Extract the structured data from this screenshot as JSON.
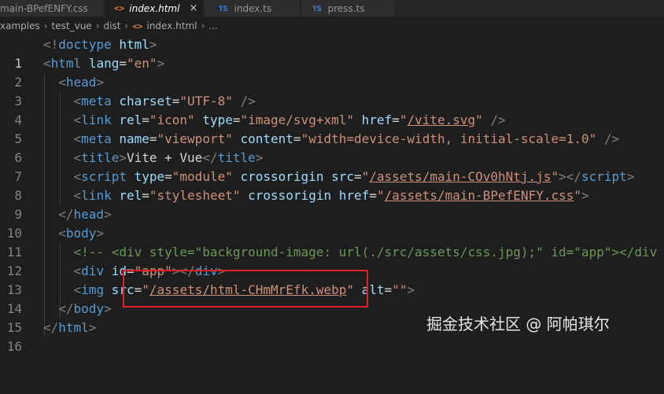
{
  "tabs": [
    {
      "label": "main-BPefENFY.css",
      "icon": "css-file-icon",
      "active": false
    },
    {
      "label": "index.html",
      "icon": "html-file-icon",
      "active": true,
      "icon_glyph": "<>",
      "close": "×"
    },
    {
      "label": "index.ts",
      "icon": "ts-file-icon",
      "active": false,
      "icon_glyph": "TS"
    },
    {
      "label": "press.ts",
      "icon": "ts-file-icon",
      "active": false,
      "icon_glyph": "TS"
    }
  ],
  "breadcrumb": {
    "items": [
      "xamples",
      "test_vue",
      "dist",
      "index.html",
      "..."
    ],
    "separator": "›",
    "file_icon_glyph": "<>"
  },
  "editor": {
    "line_numbers": [
      "1",
      "2",
      "3",
      "4",
      "5",
      "6",
      "7",
      "8",
      "9",
      "10",
      "11",
      "12",
      "13",
      "14",
      "15",
      "16"
    ],
    "current_line": "1",
    "lines": {
      "l1": {
        "lt": "<!",
        "tag": "doctype",
        "sp": " ",
        "attr": "html",
        "gt": ">"
      },
      "l2": {
        "lt": "<",
        "tag": "html",
        "attr": "lang",
        "eq": "=",
        "val": "\"en\"",
        "gt": ">"
      },
      "l3": {
        "lt": "<",
        "tag": "head",
        "gt": ">"
      },
      "l4": {
        "lt": "<",
        "tag": "meta",
        "attr": "charset",
        "eq": "=",
        "val": "\"UTF-8\"",
        "gt": "/>"
      },
      "l5": {
        "lt": "<",
        "tag": "link",
        "a1": "rel",
        "v1": "\"icon\"",
        "a2": "type",
        "v2": "\"image/svg+xml\"",
        "a3": "href",
        "q1": "\"",
        "link": "/vite.svg",
        "q2": "\"",
        "gt": "/>"
      },
      "l6": {
        "lt": "<",
        "tag": "meta",
        "a1": "name",
        "v1": "\"viewport\"",
        "a2": "content",
        "v2": "\"width=device-width, initial-scale=1.0\"",
        "gt": "/>"
      },
      "l7": {
        "lt": "<",
        "tag": "title",
        "gt": ">",
        "text": "Vite + Vue",
        "clt": "</",
        "ctag": "title",
        "cgt": ">"
      },
      "l8": {
        "lt": "<",
        "tag": "script",
        "a1": "type",
        "v1": "\"module\"",
        "a2": "crossorigin",
        "a3": "src",
        "q1": "\"",
        "link": "/assets/main-COv0hNtj.js",
        "q2": "\"",
        "gt": ">",
        "clt": "</",
        "ctag": "script",
        "cgt": ">"
      },
      "l9": {
        "lt": "<",
        "tag": "link",
        "a1": "rel",
        "v1": "\"stylesheet\"",
        "a2": "crossorigin",
        "a3": "href",
        "q1": "\"",
        "link": "/assets/main-BPefENFY.css",
        "q2": "\"",
        "gt": ">"
      },
      "l10": {
        "lt": "</",
        "tag": "head",
        "gt": ">"
      },
      "l11": {
        "lt": "<",
        "tag": "body",
        "gt": ">"
      },
      "l12": {
        "comment": "<!-- <div style=\"background-image: url(./src/assets/css.jpg);\" id=\"app\"></div"
      },
      "l13": {
        "lt": "<",
        "tag": "div",
        "attr": "id",
        "eq": "=",
        "val": "\"app\"",
        "gt": ">",
        "clt": "</",
        "ctag": "div",
        "cgt": ">"
      },
      "l14": {
        "lt": "<",
        "tag": "img",
        "a1": "src",
        "q1": "\"",
        "link": "/assets/html-CHmMrEfk.webp",
        "q2": "\"",
        "a2": "alt",
        "v2": "\"\"",
        "gt": ">"
      },
      "l15": {
        "lt": "</",
        "tag": "body",
        "gt": ">"
      },
      "l16": {
        "lt": "</",
        "tag": "html",
        "gt": ">"
      }
    }
  },
  "watermark": "掘金技术社区 @ 阿帕琪尔",
  "colors": {
    "background": "#1e1e1e",
    "tag": "#569cd6",
    "attribute": "#9cdcfe",
    "string": "#ce9178",
    "comment": "#6a9955",
    "highlight_box": "#e02020"
  }
}
